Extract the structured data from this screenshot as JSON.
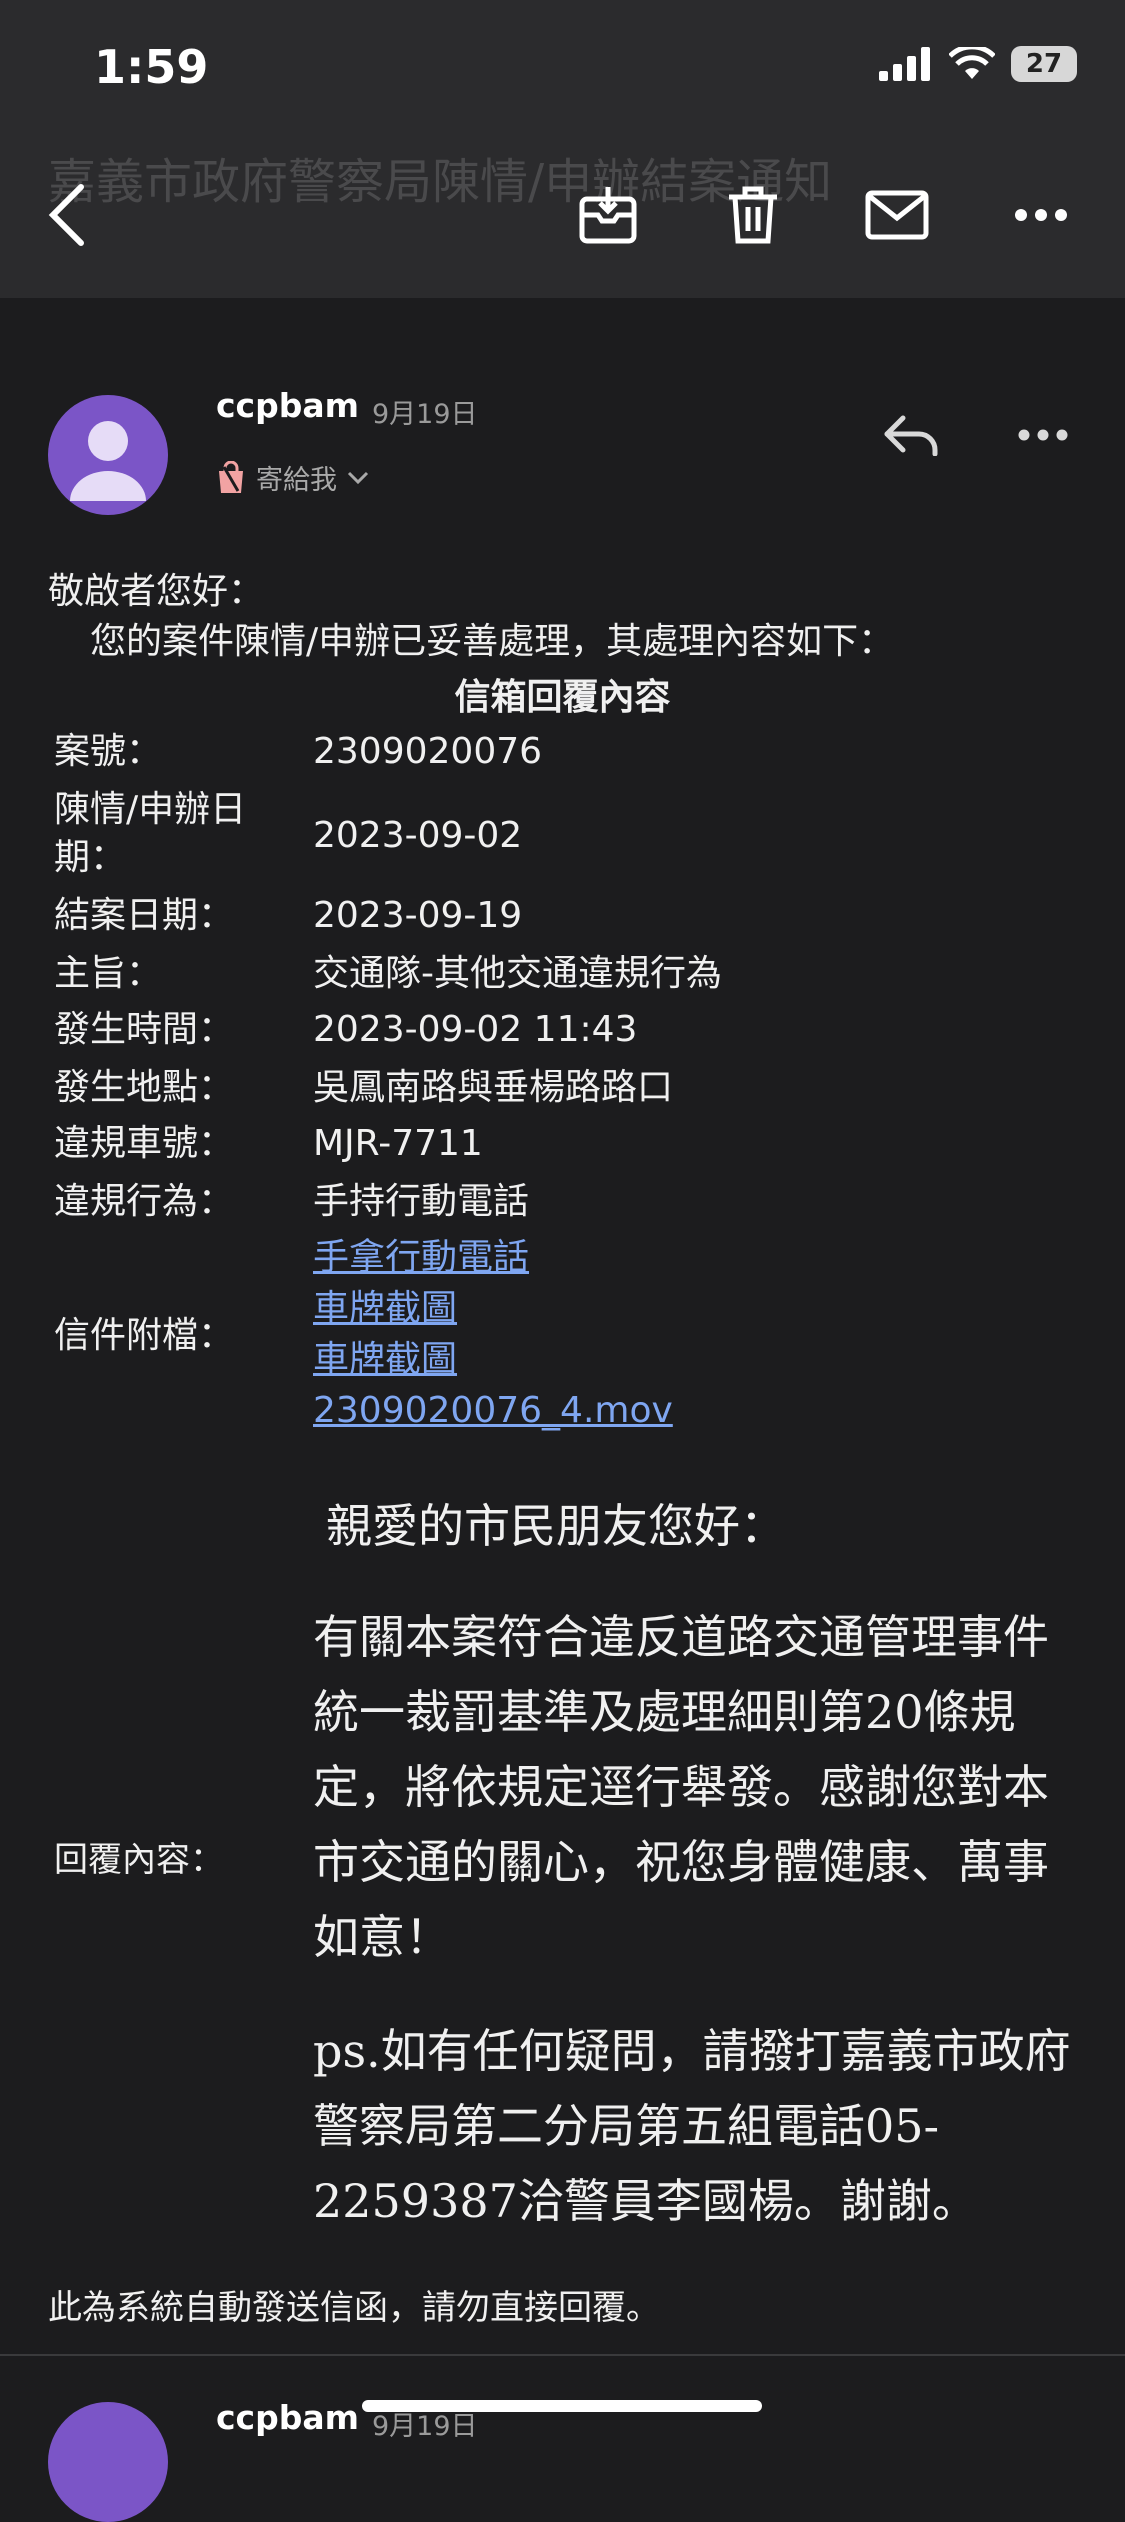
{
  "status_bar": {
    "time": "1:59",
    "battery": "27"
  },
  "header": {
    "subject": "嘉義市政府警察局陳情/申辦結案通知"
  },
  "message": {
    "sender": "ccpbam",
    "date": "9月19日",
    "to_label": "寄給我",
    "greeting": "敬啟者您好：",
    "intro": "您的案件陳情/申辦已妥善處理，其處理內容如下：",
    "box_title": "信箱回覆內容",
    "fields": [
      {
        "label": "案號：",
        "value": "2309020076"
      },
      {
        "label": "陳情/申辦日期：",
        "value": "2023-09-02"
      },
      {
        "label": "結案日期：",
        "value": "2023-09-19"
      },
      {
        "label": "主旨：",
        "value": "交通隊-其他交通違規行為"
      },
      {
        "label": "發生時間：",
        "value": "2023-09-02 11:43"
      },
      {
        "label": "發生地點：",
        "value": "吳鳳南路與垂楊路路口"
      },
      {
        "label": "違規車號：",
        "value": "MJR-7711"
      },
      {
        "label": "違規行為：",
        "value": "手持行動電話"
      }
    ],
    "attachments_label": "信件附檔：",
    "attachments": [
      "手拿行動電話",
      "車牌截圖",
      "車牌截圖",
      "2309020076_4.mov"
    ],
    "reply_label": "回覆內容：",
    "reply_greeting": "親愛的市民朋友您好：",
    "reply_body": "有關本案符合違反道路交通管理事件統一裁罰基準及處理細則第20條規定，將依規定逕行舉發。感謝您對本市交通的關心，祝您身體健康、萬事如意！",
    "reply_ps": "ps.如有任何疑問，請撥打嘉義市政府警察局第二分局第五組電話05-2259387洽警員李國楊。謝謝。",
    "footer": "此為系統自動發送信函，請勿直接回覆。"
  },
  "next_message": {
    "sender": "ccpbam",
    "date": "9月19日"
  },
  "colors": {
    "background": "#1c1c1e",
    "link": "#7fa6f1",
    "avatar": "#7b55c7"
  }
}
